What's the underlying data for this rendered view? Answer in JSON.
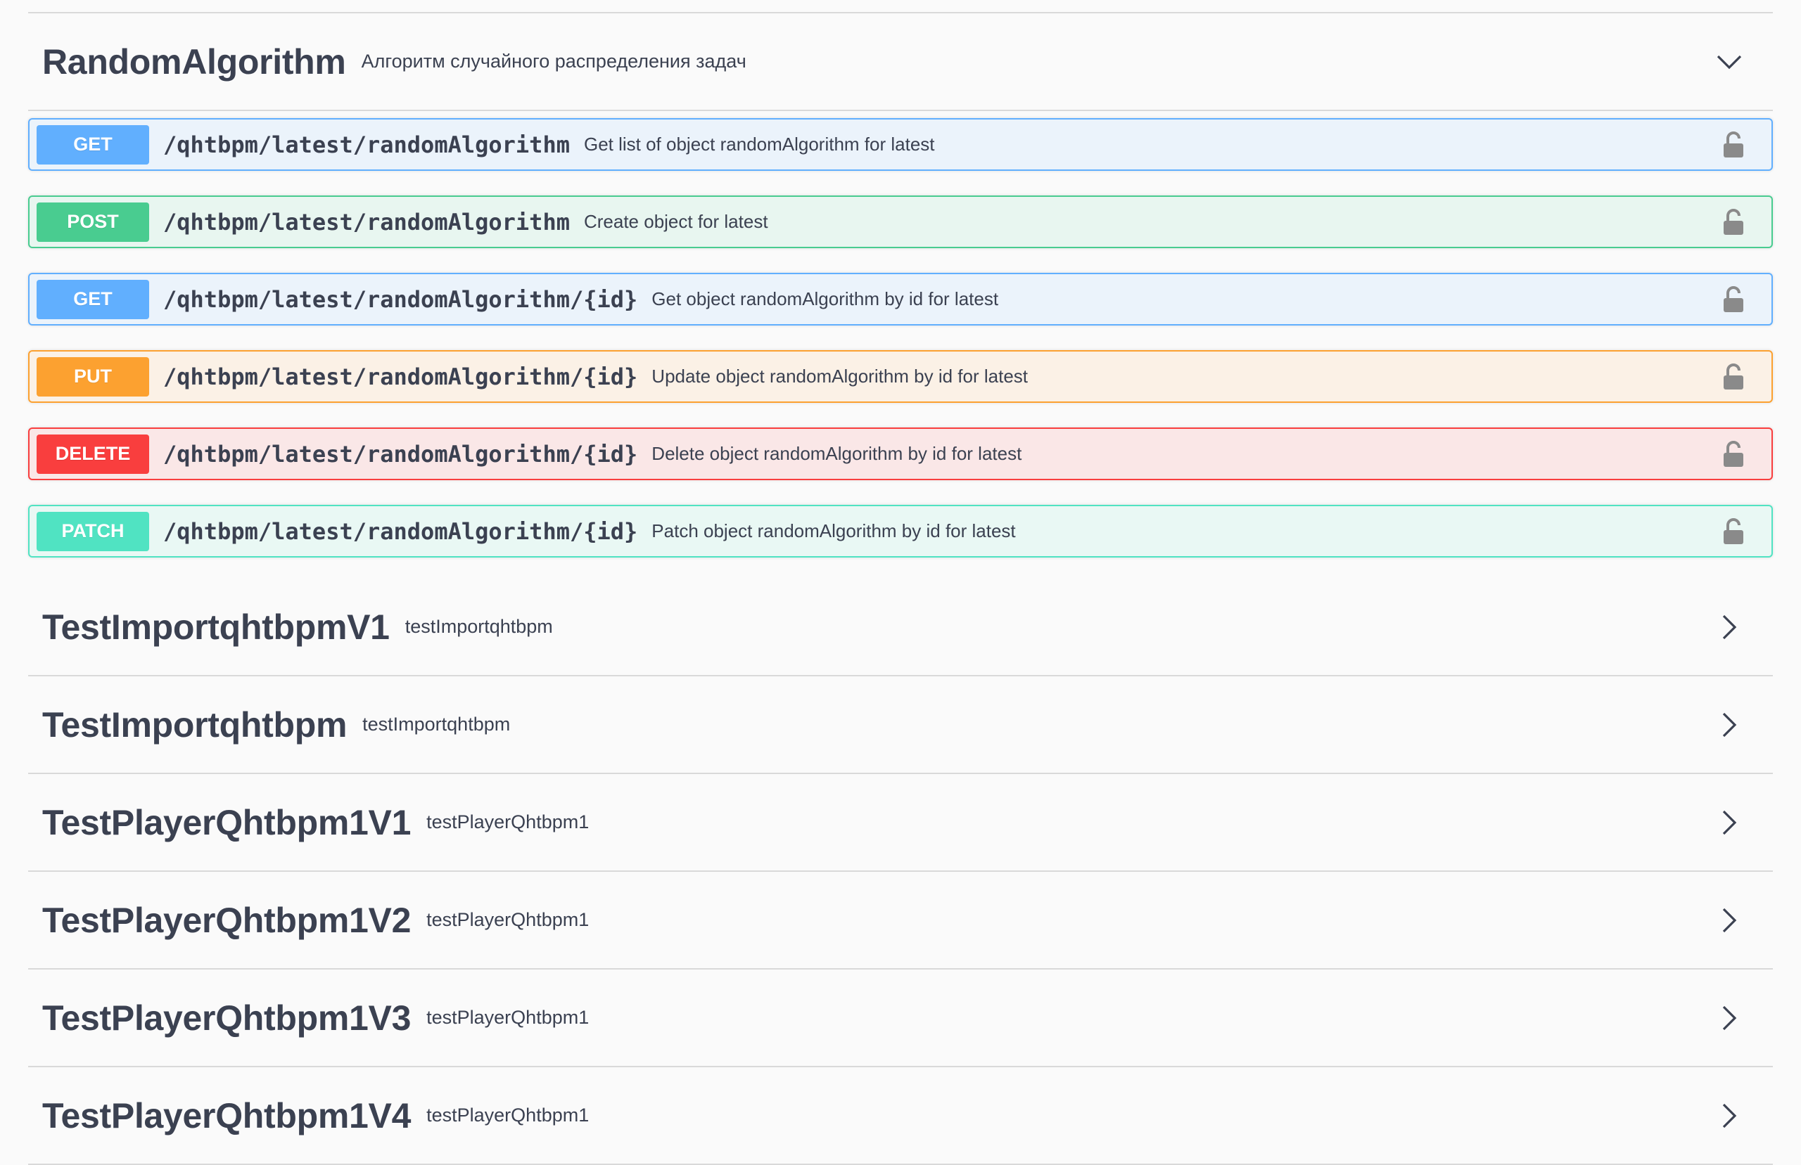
{
  "expanded_tag": {
    "title": "RandomAlgorithm",
    "description": "Алгоритм случайного распределения задач",
    "chevron_icon": "chevron-down-icon",
    "operations": [
      {
        "method": "GET",
        "path": "/qhtbpm/latest/randomAlgorithm",
        "summary": "Get list of object randomAlgorithm for latest",
        "lock_icon": "lock-icon"
      },
      {
        "method": "POST",
        "path": "/qhtbpm/latest/randomAlgorithm",
        "summary": "Create object for latest",
        "lock_icon": "lock-icon"
      },
      {
        "method": "GET",
        "path": "/qhtbpm/latest/randomAlgorithm/{id}",
        "summary": "Get object randomAlgorithm by id for latest",
        "lock_icon": "lock-icon"
      },
      {
        "method": "PUT",
        "path": "/qhtbpm/latest/randomAlgorithm/{id}",
        "summary": "Update object randomAlgorithm by id for latest",
        "lock_icon": "lock-icon"
      },
      {
        "method": "DELETE",
        "path": "/qhtbpm/latest/randomAlgorithm/{id}",
        "summary": "Delete object randomAlgorithm by id for latest",
        "lock_icon": "lock-icon"
      },
      {
        "method": "PATCH",
        "path": "/qhtbpm/latest/randomAlgorithm/{id}",
        "summary": "Patch object randomAlgorithm by id for latest",
        "lock_icon": "lock-icon"
      }
    ]
  },
  "collapsed_tags": [
    {
      "title": "TestImportqhtbpmV1",
      "description": "testImportqhtbpm",
      "chevron_icon": "chevron-right-icon"
    },
    {
      "title": "TestImportqhtbpm",
      "description": "testImportqhtbpm",
      "chevron_icon": "chevron-right-icon"
    },
    {
      "title": "TestPlayerQhtbpm1V1",
      "description": "testPlayerQhtbpm1",
      "chevron_icon": "chevron-right-icon"
    },
    {
      "title": "TestPlayerQhtbpm1V2",
      "description": "testPlayerQhtbpm1",
      "chevron_icon": "chevron-right-icon"
    },
    {
      "title": "TestPlayerQhtbpm1V3",
      "description": "testPlayerQhtbpm1",
      "chevron_icon": "chevron-right-icon"
    },
    {
      "title": "TestPlayerQhtbpm1V4",
      "description": "testPlayerQhtbpm1",
      "chevron_icon": "chevron-right-icon"
    }
  ],
  "colors": {
    "get": "#61affe",
    "post": "#49cc90",
    "put": "#fca130",
    "delete": "#f93e3e",
    "patch": "#50e3c2",
    "text": "#3b4151",
    "lock": "#8a8a8a"
  }
}
